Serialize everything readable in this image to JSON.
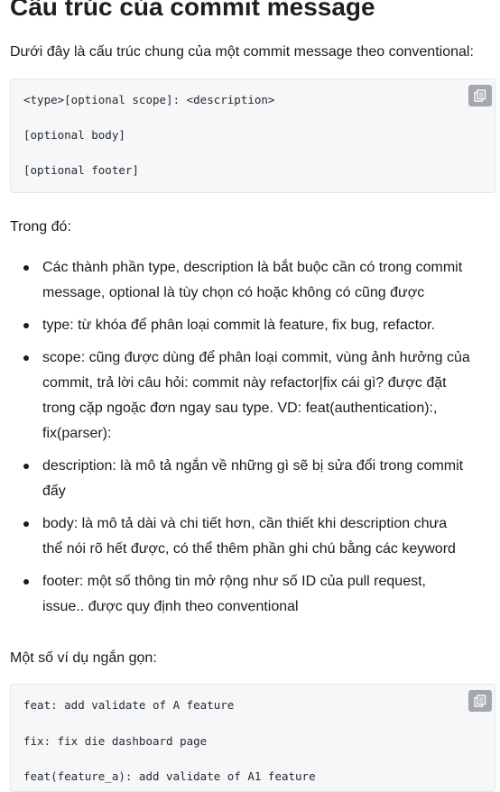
{
  "heading": "Cấu trúc của commit message",
  "intro": "Dưới đây là cấu trúc chung của một commit message theo conventional:",
  "code_block_1": {
    "lines": [
      "<type>[optional scope]: <description>",
      "[optional body]",
      "[optional footer]"
    ],
    "copy_icon": "copy-icon"
  },
  "where_label": "Trong đó:",
  "bullets": [
    {
      "lines": [
        "Các thành phần type, description là bắt buộc cần có trong commit",
        "message, optional là tùy chọn có hoặc không có cũng được"
      ]
    },
    {
      "lines": [
        "type: từ khóa để phân loại commit là feature, fix bug, refactor."
      ]
    },
    {
      "lines": [
        "scope: cũng được dùng để phân loại commit, vùng ảnh hưởng của",
        "commit, trả lời câu hỏi: commit này refactor|fix cái gì? được đặt",
        "trong cặp ngoặc đơn ngay sau type. VD: feat(authentication):,",
        "fix(parser):"
      ]
    },
    {
      "lines": [
        "description: là mô tả ngắn về những gì sẽ bị sửa đổi trong commit",
        "đấy"
      ]
    },
    {
      "lines": [
        "body: là mô tả dài và chi tiết hơn, cần thiết khi description chưa",
        "thể nói rõ hết được, có thể thêm phần ghi chú bằng các keyword"
      ]
    },
    {
      "lines": [
        "footer: một số thông tin mở rộng như số ID của pull request,",
        "issue.. được quy định theo conventional"
      ]
    }
  ],
  "examples_label": "Một số ví dụ ngắn gọn:",
  "code_block_2": {
    "lines": [
      "feat: add validate of A feature",
      "fix: fix die dashboard page",
      "feat(feature_a): add validate of A1 feature"
    ],
    "copy_icon": "copy-icon"
  }
}
